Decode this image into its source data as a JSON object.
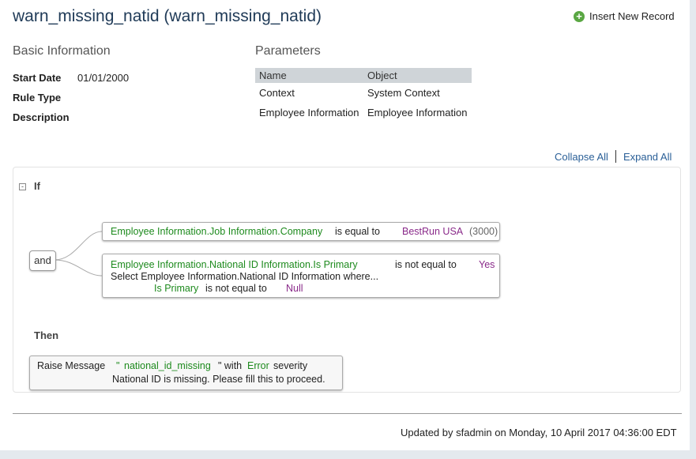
{
  "header": {
    "title": "warn_missing_natid (warn_missing_natid)",
    "insert_label": "Insert New Record"
  },
  "basic": {
    "heading": "Basic Information",
    "start_date_label": "Start Date",
    "start_date_value": "01/01/2000",
    "rule_type_label": "Rule Type",
    "description_label": "Description"
  },
  "params": {
    "heading": "Parameters",
    "columns": [
      "Name",
      "Object"
    ],
    "rows": [
      {
        "name": "Context",
        "object": "System Context"
      },
      {
        "name": "Employee Information",
        "object": "Employee Information"
      }
    ]
  },
  "toolbar": {
    "collapse_all": "Collapse All",
    "expand_all": "Expand All"
  },
  "rule": {
    "if_label": "If",
    "then_label": "Then",
    "and_label": "and",
    "cond1": {
      "field": "Employee Information.Job Information.Company",
      "op": "is equal to",
      "value": "BestRun USA",
      "value_code": "(3000)"
    },
    "cond2": {
      "field": "Employee Information.National ID Information.Is Primary",
      "op": "is not equal to",
      "value": "Yes",
      "select_text": "Select Employee Information.National ID Information where...",
      "sub_field": "Is Primary",
      "sub_op": "is not equal to",
      "sub_value": "Null"
    },
    "action": {
      "verb": "Raise Message",
      "quote_open": "\"",
      "message_key": "national_id_missing",
      "quote_close": "\" with",
      "severity": "Error",
      "severity_suffix": "severity",
      "message_text": "National ID is missing. Please fill this to proceed."
    }
  },
  "footer": {
    "updated": "Updated by sfadmin on Monday, 10 April 2017 04:36:00 EDT"
  },
  "colors": {
    "title": "#1f3a57",
    "link": "#2a5f97",
    "field_green": "#1d8a1d",
    "value_purple": "#8a2a8a",
    "insert_plus": "#5aa743"
  }
}
